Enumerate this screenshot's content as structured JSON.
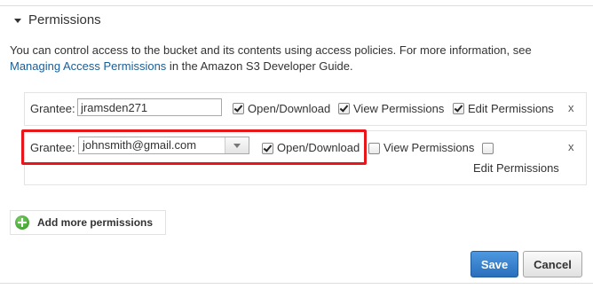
{
  "section": {
    "title": "Permissions"
  },
  "description": {
    "text_before": "You can control access to the bucket and its contents using access policies. For more information, see ",
    "link": "Managing Access Permissions",
    "text_after": " in the Amazon S3 Developer Guide."
  },
  "grantees": [
    {
      "label": "Grantee:",
      "value": "jramsden271",
      "open_download": {
        "label": "Open/Download",
        "checked": true
      },
      "view_permissions": {
        "label": "View Permissions",
        "checked": true
      },
      "edit_permissions": {
        "label": "Edit Permissions",
        "checked": true
      },
      "remove": "x"
    },
    {
      "label": "Grantee:",
      "value": "johnsmith@gmail.com",
      "open_download": {
        "label": "Open/Download",
        "checked": true
      },
      "view_permissions": {
        "label": "View Permissions",
        "checked": false
      },
      "edit_permissions": {
        "label": "Edit Permissions",
        "checked": false
      },
      "remove": "x"
    }
  ],
  "add_more": {
    "label": "Add more permissions",
    "icon": "add-circle-icon"
  },
  "buttons": {
    "save": "Save",
    "cancel": "Cancel"
  },
  "colors": {
    "accent": "#2a6fbd",
    "highlight": "#e8151a",
    "link": "#1a5e96",
    "add_icon": "#3a9d28"
  }
}
